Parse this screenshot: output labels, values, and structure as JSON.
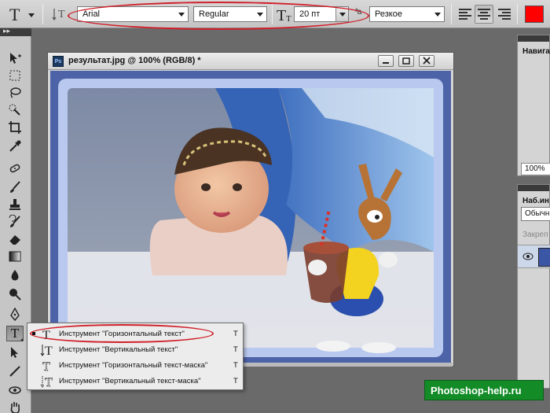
{
  "options_bar": {
    "font_family": "Arial",
    "font_style": "Regular",
    "font_size": "20 пт",
    "antialias": "Резкое",
    "text_color": "#ff0000"
  },
  "document": {
    "title": "результат.jpg @ 100% (RGB/8) *",
    "app_badge": "Ps"
  },
  "panels": {
    "navigator": {
      "title": "Навига",
      "zoom": "100%"
    },
    "layers": {
      "title": "Наб.ин",
      "blend_mode": "Обычн",
      "lock_label": "Закреп"
    }
  },
  "tool_flyout": {
    "items": [
      {
        "label": "Инструмент \"Горизонтальный текст\"",
        "shortcut": "T"
      },
      {
        "label": "Инструмент \"Вертикальный текст\"",
        "shortcut": "T"
      },
      {
        "label": "Инструмент \"Горизонтальный текст-маска\"",
        "shortcut": "T"
      },
      {
        "label": "Инструмент \"Вертикальный текст-маска\"",
        "shortcut": "T"
      }
    ]
  },
  "watermark": "Photoshop-help.ru",
  "annotation_color": "#d0202a"
}
